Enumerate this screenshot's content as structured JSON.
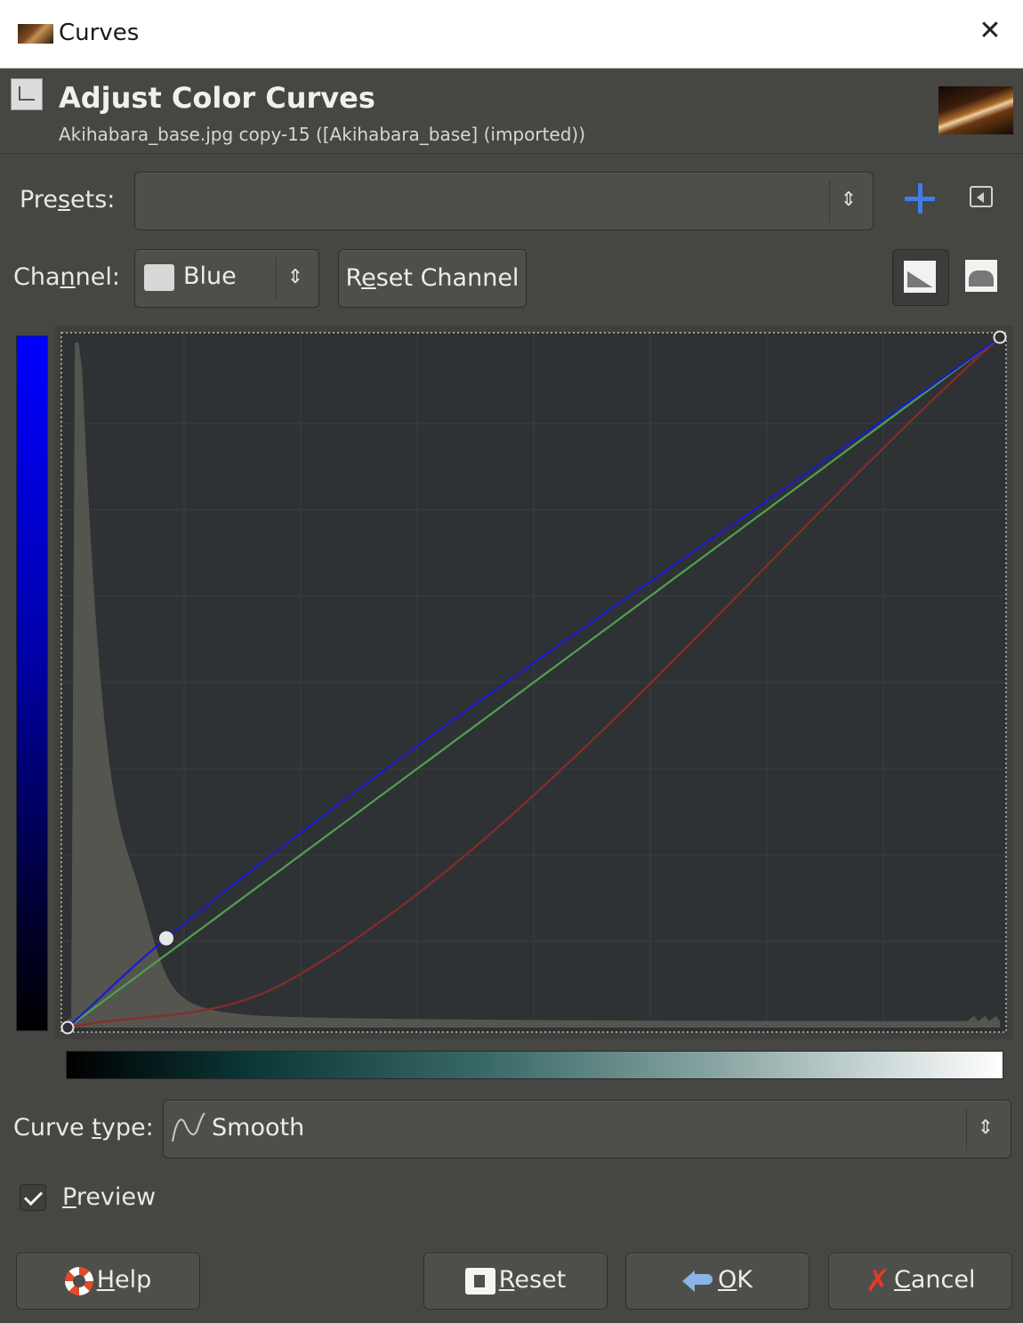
{
  "window": {
    "title": "Curves"
  },
  "header": {
    "title": "Adjust Color Curves",
    "subtitle": "Akihabara_base.jpg copy-15 ([Akihabara_base] (imported))"
  },
  "presets": {
    "label_pre": "Pre",
    "label_key": "s",
    "label_post": "ets:",
    "value": ""
  },
  "channel": {
    "label_pre": "Cha",
    "label_key": "n",
    "label_post": "nel:",
    "value": "Blue",
    "reset_pre": "R",
    "reset_key": "e",
    "reset_post": "set Channel"
  },
  "curve_type": {
    "label_pre": "Curve ",
    "label_key": "t",
    "label_post": "ype:",
    "value": "Smooth"
  },
  "preview": {
    "key": "P",
    "rest": "review",
    "checked": true
  },
  "buttons": {
    "help_key": "H",
    "help_rest": "elp",
    "reset_key": "R",
    "reset_rest": "eset",
    "ok_key": "O",
    "ok_rest": "K",
    "cancel_key": "C",
    "cancel_rest": "ancel"
  },
  "colors": {
    "blue_curve": "#1a1ad0",
    "green_curve": "#4fa24f",
    "red_curve": "#8a2a2a",
    "accent": "#3d7ee8"
  },
  "icons": {
    "add_preset": "plus-icon",
    "preset_menu": "menu-icon",
    "linear_histogram": "linear-histogram-icon",
    "log_histogram": "log-histogram-icon"
  },
  "curves": {
    "range": [
      0,
      255
    ],
    "blue_points": [
      [
        0,
        0
      ],
      [
        27,
        33
      ],
      [
        255,
        255
      ]
    ],
    "green_points": [
      [
        0,
        0
      ],
      [
        255,
        255
      ]
    ],
    "red_points": [
      [
        0,
        0
      ],
      [
        60,
        17
      ],
      [
        255,
        255
      ]
    ]
  }
}
